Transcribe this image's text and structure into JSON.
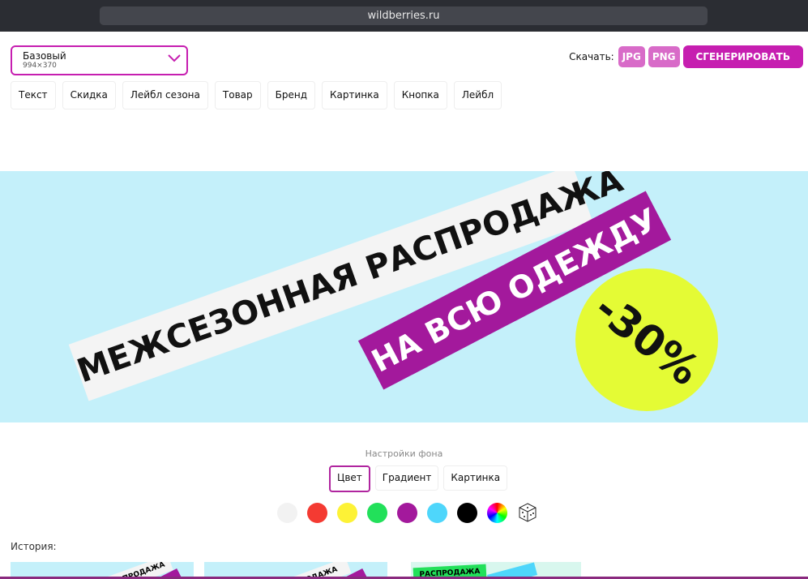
{
  "browser": {
    "url": "wildberries.ru"
  },
  "template_select": {
    "title": "Базовый",
    "size": "994×370"
  },
  "element_tabs": [
    "Текст",
    "Скидка",
    "Лейбл сезона",
    "Товар",
    "Бренд",
    "Картинка",
    "Кнопка",
    "Лейбл"
  ],
  "download": {
    "label": "Скачать:",
    "jpg": "JPG",
    "png": "PNG",
    "generate": "СГЕНЕРИРОВАТЬ"
  },
  "banner": {
    "headline": "МЕЖСЕЗОННАЯ РАСПРОДАЖА",
    "subline": "НА ВСЮ ОДЕЖДУ",
    "discount": "-30%",
    "background": "#c4f0fa"
  },
  "background_settings": {
    "title": "Настройки фона",
    "tabs": [
      "Цвет",
      "Градиент",
      "Картинка"
    ],
    "active_tab": "Цвет",
    "colors": [
      "#f2f2f2",
      "#f43a32",
      "#fdf236",
      "#22e05a",
      "#a3199c",
      "#4ed6fb",
      "#000000"
    ]
  },
  "history": {
    "label": "История:",
    "items": [
      "РАСПРОДАЖА",
      "ОДАЖА",
      "РАСПРОДАЖА"
    ]
  }
}
